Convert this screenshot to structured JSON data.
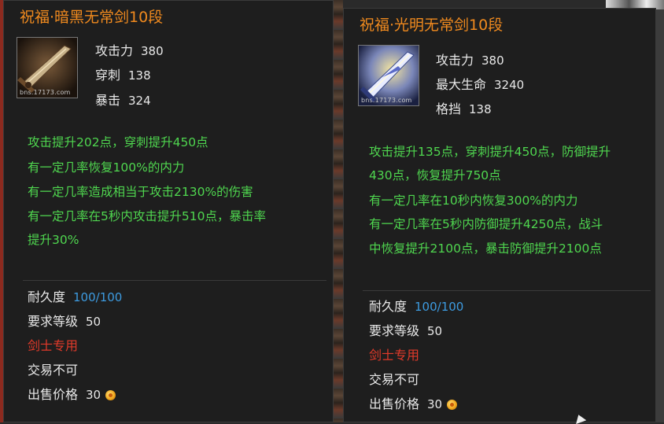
{
  "left_item": {
    "title": "祝福·暗黑无常剑10段",
    "icon_name": "dark-sword-icon",
    "icon_caption": "bns.17173.com",
    "stats": [
      {
        "label": "攻击力",
        "value": "380"
      },
      {
        "label": "穿刺",
        "value": "138"
      },
      {
        "label": "暴击",
        "value": "324"
      }
    ],
    "effects": [
      "攻击提升202点，穿刺提升450点",
      "有一定几率恢复100%的内力",
      "有一定几率造成相当于攻击2130%的伤害",
      "有一定几率在5秒内攻击提升510点，暴击率",
      "提升30%"
    ],
    "durability_label": "耐久度",
    "durability_value": "100/100",
    "level_label": "要求等级",
    "level_value": "50",
    "class_restriction": "剑士专用",
    "trade_status": "交易不可",
    "price_label": "出售价格",
    "price_value": "30"
  },
  "right_item": {
    "title": "祝福·光明无常剑10段",
    "icon_name": "light-sword-icon",
    "icon_caption": "bns.17173.com",
    "stats": [
      {
        "label": "攻击力",
        "value": "380"
      },
      {
        "label": "最大生命",
        "value": "3240"
      },
      {
        "label": "格挡",
        "value": "138"
      }
    ],
    "effects": [
      "攻击提升135点，穿刺提升450点，防御提升",
      "430点，恢复提升750点",
      "有一定几率在10秒内恢复300%的内力",
      "有一定几率在5秒内防御提升4250点，战斗",
      "中恢复提升2100点，暴击防御提升2100点"
    ],
    "durability_label": "耐久度",
    "durability_value": "100/100",
    "level_label": "要求等级",
    "level_value": "50",
    "class_restriction": "剑士专用",
    "trade_status": "交易不可",
    "price_label": "出售价格",
    "price_value": "30"
  },
  "colors": {
    "title": "#f08a1e",
    "effect": "#4fd64f",
    "durability": "#3d9be0",
    "restriction": "#e23a2a",
    "panel_bg": "#1e1e1e"
  },
  "icons": [
    "dark-sword-icon",
    "light-sword-icon",
    "gold-coin-icon",
    "mouse-cursor-icon"
  ]
}
